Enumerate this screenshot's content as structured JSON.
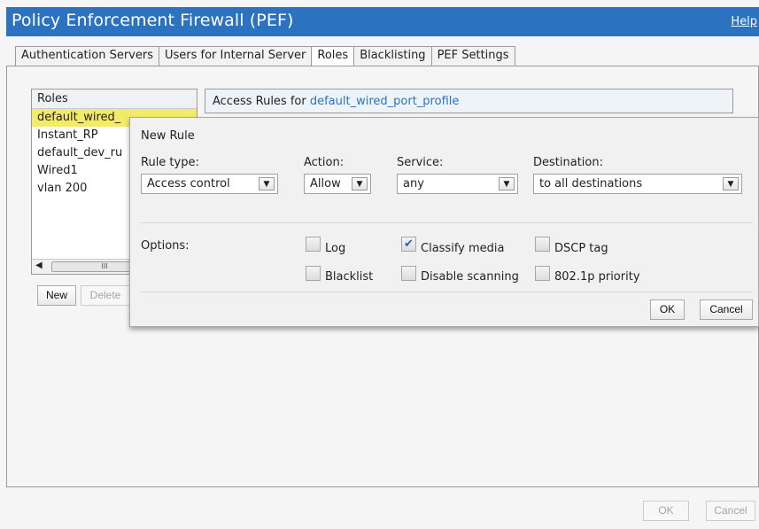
{
  "window": {
    "title": "Policy Enforcement Firewall (PEF)",
    "help_label": "Help"
  },
  "tabs": [
    {
      "label": "Authentication Servers",
      "active": false
    },
    {
      "label": "Users for Internal Server",
      "active": false
    },
    {
      "label": "Roles",
      "active": true
    },
    {
      "label": "Blacklisting",
      "active": false
    },
    {
      "label": "PEF Settings",
      "active": false
    }
  ],
  "roles": {
    "header": "Roles",
    "items": [
      {
        "label": "default_wired_",
        "selected": true
      },
      {
        "label": "Instant_RP",
        "selected": false
      },
      {
        "label": "default_dev_ru",
        "selected": false
      },
      {
        "label": "Wired1",
        "selected": false
      },
      {
        "label": "vlan 200",
        "selected": false
      }
    ],
    "scroll_thumb_glyph": "III",
    "scroll_left_glyph": "◀",
    "new_label": "New",
    "delete_label": "Delete"
  },
  "access_rules": {
    "label_prefix": "Access Rules for ",
    "profile": "default_wired_port_profile"
  },
  "new_rule": {
    "title": "New Rule",
    "rule_type": {
      "label": "Rule type:",
      "value": "Access control"
    },
    "action": {
      "label": "Action:",
      "value": "Allow"
    },
    "service": {
      "label": "Service:",
      "value": "any"
    },
    "destination": {
      "label": "Destination:",
      "value": "to all destinations"
    },
    "options_label": "Options:",
    "options": {
      "log": {
        "label": "Log",
        "checked": false
      },
      "classify_media": {
        "label": "Classify media",
        "checked": true
      },
      "dscp_tag": {
        "label": "DSCP tag",
        "checked": false
      },
      "blacklist": {
        "label": "Blacklist",
        "checked": false
      },
      "disable_scanning": {
        "label": "Disable scanning",
        "checked": false
      },
      "dot1p_priority": {
        "label": "802.1p priority",
        "checked": false
      }
    },
    "ok_label": "OK",
    "cancel_label": "Cancel",
    "dropdown_glyph": "▼",
    "check_glyph": "✔"
  },
  "footer": {
    "ok_label": "OK",
    "cancel_label": "Cancel"
  },
  "colors": {
    "titlebar": "#2b72c0",
    "selection": "#f5ea67",
    "link": "#2a74c0"
  }
}
